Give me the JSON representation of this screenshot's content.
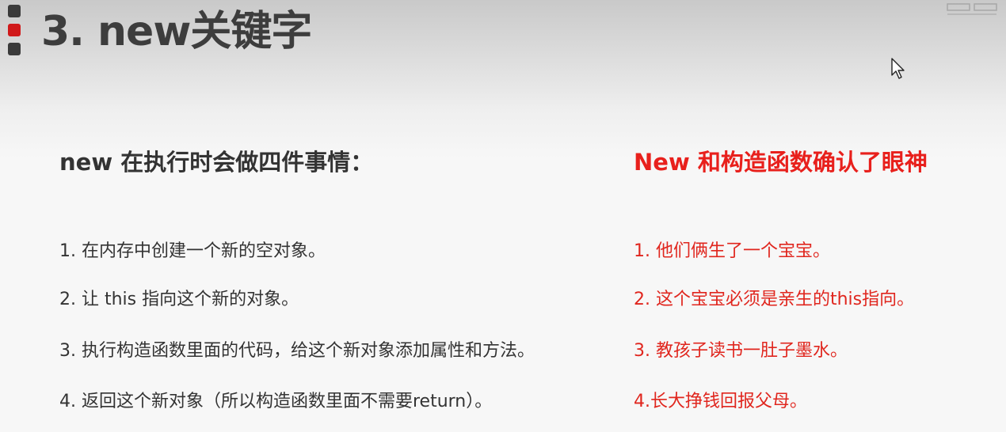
{
  "slide": {
    "title": "3. new关键字",
    "left": {
      "heading": "new 在执行时会做四件事情：",
      "items": [
        "1. 在内存中创建一个新的空对象。",
        "2. 让 this 指向这个新的对象。",
        "3. 执行构造函数里面的代码，给这个新对象添加属性和方法。",
        "4. 返回这个新对象（所以构造函数里面不需要return）。"
      ]
    },
    "right": {
      "heading": "New 和构造函数确认了眼神",
      "items": [
        "1. 他们俩生了一个宝宝。",
        "2. 这个宝宝必须是亲生的this指向。",
        "3. 教孩子读书一肚子墨水。",
        "4.长大挣钱回报父母。"
      ]
    }
  },
  "colors": {
    "title": "#3d3d3d",
    "marker_accent": "#d0191a",
    "body_text": "#333333",
    "highlight": "#e8201c"
  },
  "icons": {
    "title_marker": "three-block-bullet-icon",
    "cursor": "mouse-pointer-icon",
    "corner": "window-controls-icon"
  }
}
